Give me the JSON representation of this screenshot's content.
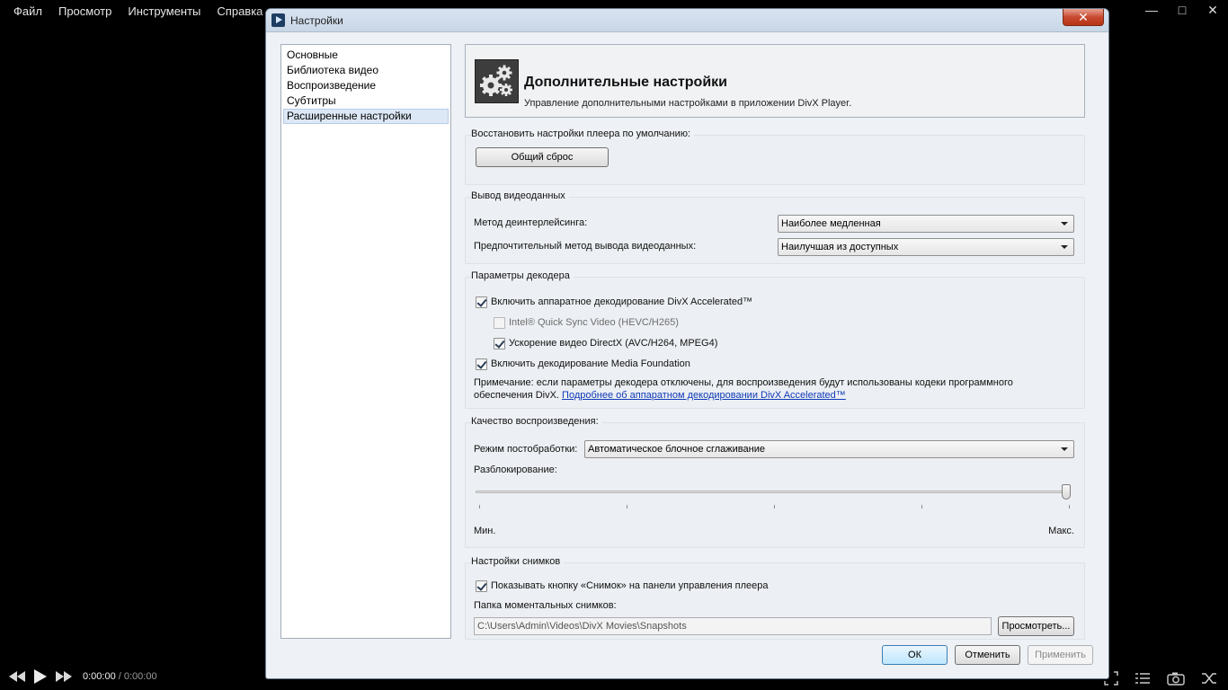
{
  "player": {
    "menu": [
      "Файл",
      "Просмотр",
      "Инструменты",
      "Справка"
    ],
    "time_current": "0:00:00",
    "time_separator": " / ",
    "time_total": "0:00:00"
  },
  "dialog": {
    "title": "Настройки",
    "close_label": "✕",
    "sidebar": [
      {
        "label": "Основные",
        "active": false
      },
      {
        "label": "Библиотека видео",
        "active": false
      },
      {
        "label": "Воспроизведение",
        "active": false
      },
      {
        "label": "Субтитры",
        "active": false
      },
      {
        "label": "Расширенные настройки",
        "active": true
      }
    ],
    "header": {
      "title": "Дополнительные настройки",
      "subtitle": "Управление дополнительными настройками в приложении DivX Player."
    },
    "reset": {
      "title": "Восстановить настройки плеера по умолчанию:",
      "button": "Общий сброс"
    },
    "video_output": {
      "title": "Вывод видеоданных",
      "deinterlace_label": "Метод деинтерлейсинга:",
      "deinterlace_value": "Наиболее медленная",
      "output_method_label": "Предпочтительный метод вывода видеоданных:",
      "output_method_value": "Наилучшая из доступных"
    },
    "decoder": {
      "title": "Параметры декодера",
      "hw_decoding": {
        "label": "Включить аппаратное декодирование DivX Accelerated™",
        "checked": true
      },
      "quick_sync": {
        "label": "Intel® Quick Sync Video (HEVC/H265)",
        "checked": false,
        "enabled": false
      },
      "directx": {
        "label": "Ускорение видео DirectX (AVC/H264, MPEG4)",
        "checked": true
      },
      "media_foundation": {
        "label": "Включить декодирование Media Foundation",
        "checked": true
      },
      "note_line1": "Примечание: если параметры декодера отключены, для воспроизведения будут использованы кодеки программного",
      "note_line2": "обеспечения DivX. ",
      "note_link": "Подробнее об аппаратном декодировании DivX Accelerated™"
    },
    "quality": {
      "title": "Качество воспроизведения:",
      "postproc_label": "Режим постобработки:",
      "postproc_value": "Автоматическое блочное сглаживание",
      "deblock_label": "Разблокирование:",
      "slider_min": "Мин.",
      "slider_max": "Макс.",
      "slider_value": 1.0
    },
    "snapshots": {
      "title": "Настройки снимков",
      "show_button": {
        "label": "Показывать кнопку «Снимок» на панели управления плеера",
        "checked": true
      },
      "folder_label": "Папка моментальных снимков:",
      "folder_path": "C:\\Users\\Admin\\Videos\\DivX Movies\\Snapshots",
      "browse": "Просмотреть..."
    },
    "buttons": {
      "ok": "ОК",
      "cancel": "Отменить",
      "apply": "Применить"
    }
  }
}
